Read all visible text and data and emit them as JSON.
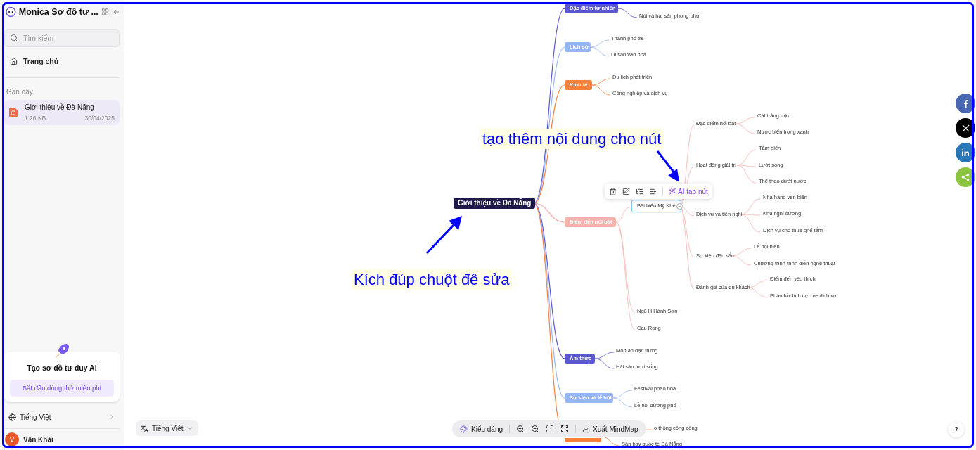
{
  "sidebar": {
    "title": "Monica Sơ đồ tư ...",
    "search": {
      "placeholder": "Tìm kiếm"
    },
    "nav": [
      {
        "label": "Trang chủ",
        "selected": false
      }
    ],
    "recent_heading": "Gần đây",
    "recent": [
      {
        "title": "Giới thiệu về Đà Nẵng",
        "size": "1.26 KB",
        "date": "30/04/2025",
        "selected": true
      }
    ],
    "promo": {
      "title": "Tạo sơ đồ tư duy AI",
      "button": "Bắt đầu dùng thử miễn phí"
    },
    "language": "Tiếng Việt",
    "user": {
      "initial": "V",
      "name": "Văn Khải"
    }
  },
  "mindmap": {
    "root": {
      "label": "Giới thiệu về Đà Nẵng"
    },
    "branches": [
      {
        "label": "Đặc điểm tự nhiên",
        "color": "#5b57d1",
        "children": [
          {
            "label": "Núi và hải sản phong phú",
            "selected": false
          }
        ]
      },
      {
        "label": "Lịch sử",
        "color": "#96b5f7",
        "children": [
          {
            "label": "Thành phố trẻ",
            "selected": false
          },
          {
            "label": "Di sản văn hóa",
            "selected": false
          }
        ]
      },
      {
        "label": "Kinh tế",
        "color": "#f5813d",
        "children": [
          {
            "label": "Du lịch phát triển",
            "selected": false
          },
          {
            "label": "Công nghiệp và dịch vụ",
            "selected": false
          }
        ]
      },
      {
        "label": "Điểm đến nổi bật",
        "color": "#f8b1ac",
        "children": [
          {
            "label": "Bãi biển Mỹ Khê",
            "selected": true,
            "children": [
              {
                "label": "Đặc điểm nổi bật",
                "children": [
                  {
                    "label": "Cát trắng mịn"
                  },
                  {
                    "label": "Nước biển trong xanh"
                  }
                ]
              },
              {
                "label": "Hoạt động giải trí",
                "children": [
                  {
                    "label": "Tắm biển"
                  },
                  {
                    "label": "Lướt sóng"
                  },
                  {
                    "label": "Thể thao dưới nước"
                  }
                ]
              },
              {
                "label": "Dịch vụ và tiện nghi",
                "children": [
                  {
                    "label": "Nhà hàng ven biển"
                  },
                  {
                    "label": "Khu nghỉ dưỡng"
                  },
                  {
                    "label": "Dịch vụ cho thuê ghế tắm"
                  }
                ]
              },
              {
                "label": "Sự kiện đặc sắc",
                "children": [
                  {
                    "label": "Lễ hội biển"
                  },
                  {
                    "label": "Chương trình trình diễn nghệ thuật"
                  }
                ]
              },
              {
                "label": "Đánh giá của du khách",
                "children": [
                  {
                    "label": "Điểm đến yêu thích"
                  },
                  {
                    "label": "Phản hồi tích cực về dịch vụ"
                  }
                ]
              }
            ]
          },
          {
            "label": "Ngũ H Hành Sơn",
            "selected": false
          },
          {
            "label": "Cầu Rồng",
            "selected": false
          }
        ]
      },
      {
        "label": "Ẩm thực",
        "color": "#5b57d1",
        "children": [
          {
            "label": "Món ăn đặc trưng",
            "selected": false
          },
          {
            "label": "Hải sản tươi sống",
            "selected": false
          }
        ]
      },
      {
        "label": "Sự kiện và lễ hội",
        "color": "#96b5f7",
        "children": [
          {
            "label": "Festival pháo hoa",
            "selected": false
          },
          {
            "label": "Lễ hội đường phố",
            "selected": false
          }
        ]
      },
      {
        "color": "#f5813d",
        "children": [
          {
            "label": "o thông công cộng",
            "selected": false
          },
          {
            "label": "Sân bay quốc tế Đà Nẵng",
            "selected": false
          }
        ]
      }
    ]
  },
  "node_toolbar": {
    "ai_button": "AI tạo nút"
  },
  "annotations": [
    {
      "text": "tạo thêm nội dung cho nút"
    },
    {
      "text": "Kích đúp chuột đê sửa"
    }
  ],
  "language_button": "Tiếng Việt",
  "bottom_toolbar": {
    "style_button": "Kiểu dáng",
    "export_button": "Xuất MindMap"
  },
  "help": "?"
}
